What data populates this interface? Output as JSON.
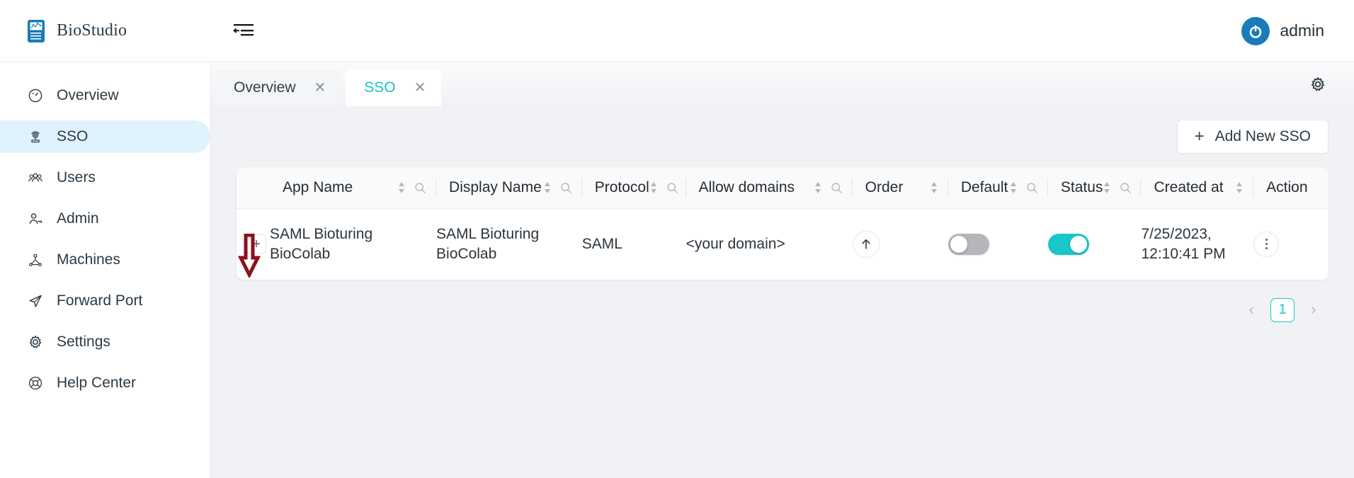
{
  "app": {
    "brand": "BioStudio",
    "brand_color": "#1a7cb8",
    "accent_color": "#18c8c8",
    "annotation_color": "#8c1018"
  },
  "topbar": {
    "collapse_icon": "collapse-sidebar-icon",
    "user": "admin",
    "avatar_icon": "power-avatar-icon"
  },
  "sidebar": {
    "items": [
      {
        "label": "Overview",
        "icon": "gauge-icon",
        "active": false
      },
      {
        "label": "SSO",
        "icon": "sso-network-icon",
        "active": true
      },
      {
        "label": "Users",
        "icon": "users-icon",
        "active": false
      },
      {
        "label": "Admin",
        "icon": "user-key-icon",
        "active": false
      },
      {
        "label": "Machines",
        "icon": "machines-icon",
        "active": false
      },
      {
        "label": "Forward Port",
        "icon": "send-icon",
        "active": false
      },
      {
        "label": "Settings",
        "icon": "gear-icon",
        "active": false
      },
      {
        "label": "Help Center",
        "icon": "lifebuoy-icon",
        "active": false
      }
    ]
  },
  "tabs": {
    "items": [
      {
        "label": "Overview",
        "active": false,
        "close": "✕"
      },
      {
        "label": "SSO",
        "active": true,
        "close": "✕"
      }
    ],
    "settings_icon": "gear-icon"
  },
  "toolbar": {
    "add_label": "Add New SSO",
    "add_plus": "+"
  },
  "table": {
    "columns": [
      {
        "label": "App Name",
        "sortable": true,
        "searchable": true,
        "divider": true
      },
      {
        "label": "Display Name",
        "sortable": true,
        "searchable": true,
        "divider": true
      },
      {
        "label": "Protocol",
        "sortable": true,
        "searchable": true,
        "divider": true
      },
      {
        "label": "Allow domains",
        "sortable": true,
        "searchable": true,
        "divider": true
      },
      {
        "label": "Order",
        "sortable": true,
        "searchable": false,
        "divider": true
      },
      {
        "label": "Default",
        "sortable": true,
        "searchable": true,
        "divider": true
      },
      {
        "label": "Status",
        "sortable": true,
        "searchable": true,
        "divider": true
      },
      {
        "label": "Created at",
        "sortable": true,
        "searchable": false,
        "divider": true
      },
      {
        "label": "Action",
        "sortable": false,
        "searchable": false,
        "divider": false
      }
    ],
    "rows": [
      {
        "expand": "+",
        "app_name": "SAML Bioturing BioColab",
        "display_name": "SAML Bioturing BioColab",
        "protocol": "SAML",
        "allow_domains": "<your domain>",
        "order_icon": "arrow-up-icon",
        "default_on": false,
        "status_on": true,
        "created_at": "7/25/2023, 12:10:41 PM",
        "action_icon": "kebab-menu-icon"
      }
    ]
  },
  "pagination": {
    "prev": "‹",
    "next": "›",
    "current": "1"
  }
}
